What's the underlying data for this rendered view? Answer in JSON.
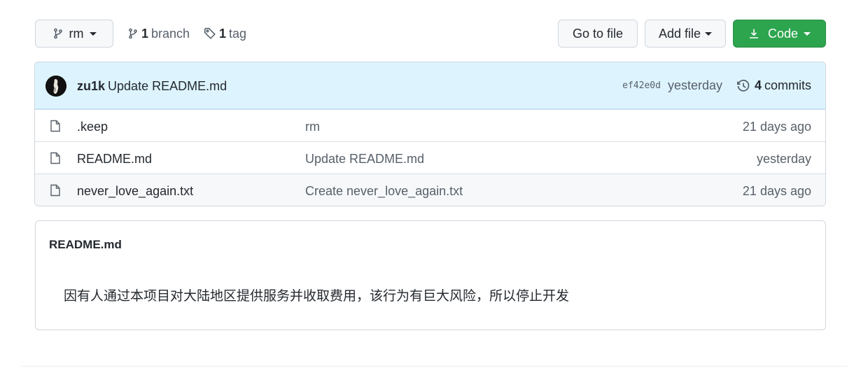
{
  "toolbar": {
    "branch": "rm",
    "branch_count": "1",
    "branch_label": "branch",
    "tag_count": "1",
    "tag_label": "tag",
    "go_to_file": "Go to file",
    "add_file": "Add file",
    "code": "Code"
  },
  "commit": {
    "author": "zu1k",
    "message": "Update README.md",
    "sha": "ef42e0d",
    "time": "yesterday",
    "commits_count": "4",
    "commits_label": "commits"
  },
  "files": [
    {
      "name": ".keep",
      "commit": "rm",
      "age": "21 days ago"
    },
    {
      "name": "README.md",
      "commit": "Update README.md",
      "age": "yesterday"
    },
    {
      "name": "never_love_again.txt",
      "commit": "Create never_love_again.txt",
      "age": "21 days ago"
    }
  ],
  "readme": {
    "title": "README.md",
    "body": "因有人通过本项目对大陆地区提供服务并收取费用，该行为有巨大风险，所以停止开发"
  },
  "colors": {
    "accent_green": "#2da44e",
    "commit_bar": "#ddf4ff"
  }
}
